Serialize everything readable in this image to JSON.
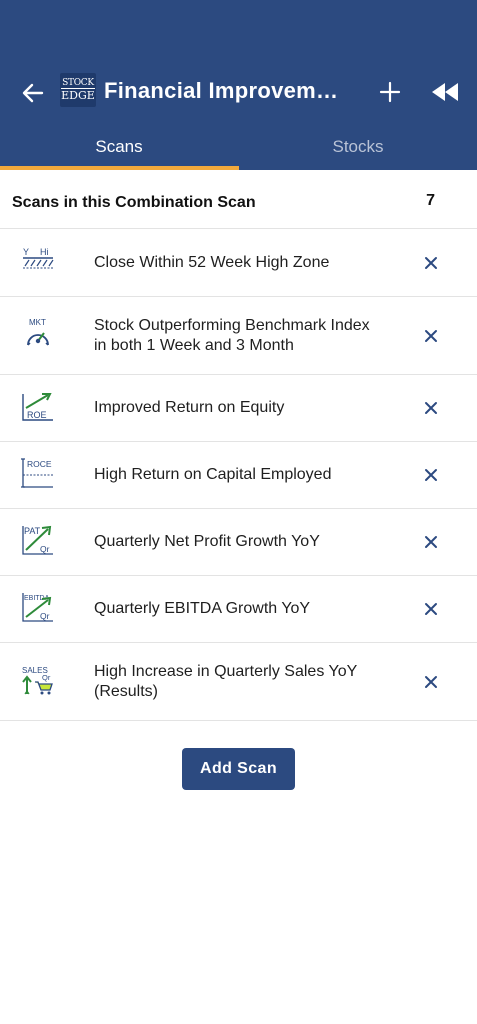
{
  "header": {
    "logo_line1": "STOCK",
    "logo_line2": "EDGE",
    "title": "Financial Improveme..."
  },
  "tabs": [
    {
      "label": "Scans",
      "active": true
    },
    {
      "label": "Stocks",
      "active": false
    }
  ],
  "section": {
    "title": "Scans in this Combination Scan",
    "count": "7"
  },
  "scans": [
    {
      "label": "Close Within 52 Week High Zone",
      "icon": "52-week-high-icon"
    },
    {
      "label": "Stock Outperforming Benchmark Index in both 1 Week and 3 Month",
      "icon": "market-speedometer-icon"
    },
    {
      "label": "Improved Return on Equity",
      "icon": "roe-trend-icon"
    },
    {
      "label": "High Return on Capital Employed",
      "icon": "roce-icon"
    },
    {
      "label": "Quarterly Net Profit Growth YoY",
      "icon": "pat-growth-icon"
    },
    {
      "label": "Quarterly EBITDA Growth YoY",
      "icon": "ebitda-growth-icon"
    },
    {
      "label": "High Increase in Quarterly Sales YoY (Results)",
      "icon": "sales-growth-icon"
    }
  ],
  "icon_text": {
    "y": "Y",
    "hi": "Hi",
    "mkt": "MKT",
    "roe": "ROE",
    "roce": "ROCE",
    "pat": "PAT",
    "qr": "Qr",
    "ebitda": "EBITDA",
    "sales": "SALES"
  },
  "add_scan_label": "Add Scan",
  "colors": {
    "header": "#2c4a80",
    "tab_indicator": "#f2a93b",
    "icon_blue": "#2c4a80",
    "icon_green": "#2e8b3a",
    "remove_x": "#2c4a80"
  }
}
